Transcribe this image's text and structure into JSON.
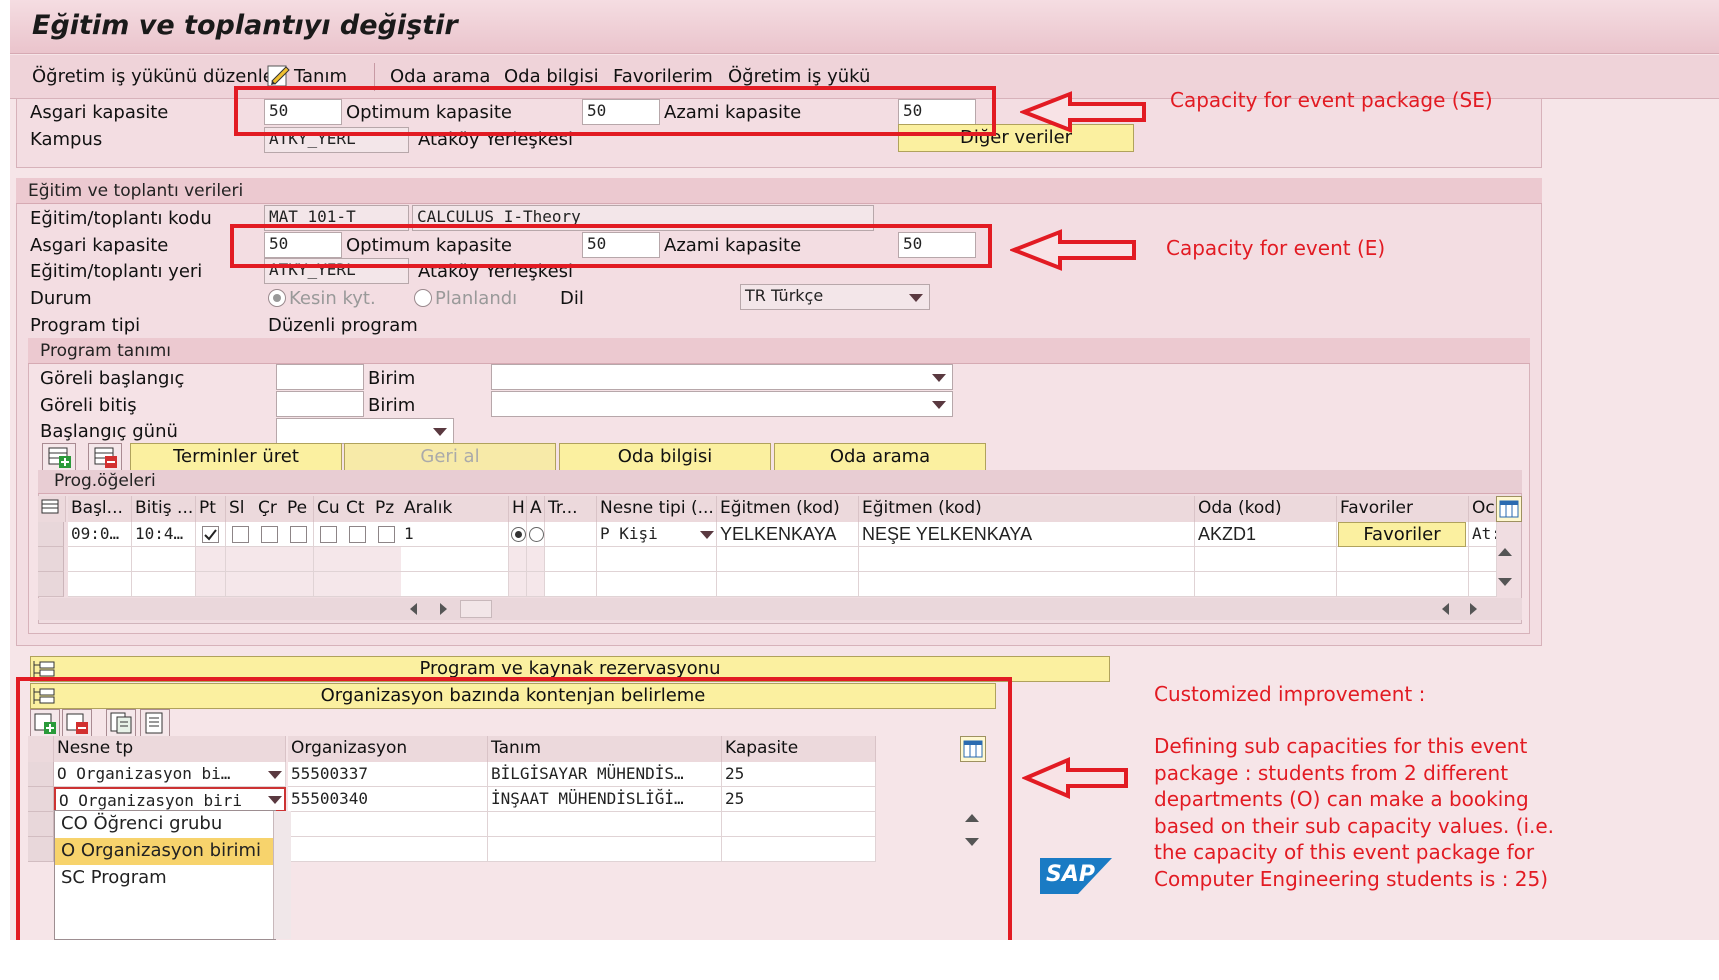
{
  "window": {
    "title": "Eğitim ve toplantıyı değiştir"
  },
  "toolbar": {
    "items": [
      "Öğretim iş yükünü düzenle",
      "Tanım",
      "Oda arama",
      "Oda bilgisi",
      "Favorilerim",
      "Öğretim iş yükü"
    ]
  },
  "package": {
    "min_label": "Asgari kapasite",
    "min_value": "50",
    "opt_label": "Optimum kapasite",
    "opt_value": "50",
    "max_label": "Azami kapasite",
    "max_value": "50",
    "campus_label": "Kampus",
    "campus_value": "ATKY_YERL",
    "campus_desc": "Ataköy Yerleşkesi",
    "other_button": "Diğer veriler"
  },
  "event": {
    "group_title": "Eğitim ve toplantı verileri",
    "code_label": "Eğitim/toplantı kodu",
    "code_value": "MAT 101-T",
    "code_desc": "CALCULUS I-Theory",
    "min_label": "Asgari kapasite",
    "min_value": "50",
    "opt_label": "Optimum kapasite",
    "opt_value": "50",
    "max_label": "Azami kapasite",
    "max_value": "50",
    "location_label": "Eğitim/toplantı yeri",
    "location_value": "ATKY_YERL",
    "location_desc": "Ataköy Yerleşkesi",
    "status_label": "Durum",
    "status_opt1": "Kesin kyt.",
    "status_opt2": "Planlandı",
    "lang_label": "Dil",
    "lang_value": "TR Türkçe",
    "program_type_label": "Program tipi",
    "program_type_value": "Düzenli program"
  },
  "program": {
    "group_title": "Program tanımı",
    "rel_start_label": "Göreli başlangıç",
    "rel_end_label": "Göreli bitiş",
    "unit_label": "Birim",
    "start_day_label": "Başlangıç günü",
    "buttons": [
      "Terminler üret",
      "Geri al",
      "Oda bilgisi",
      "Oda arama"
    ],
    "items_title": "Prog.öğeleri",
    "columns": [
      "Başl...",
      "Bitiş ...",
      "Pt",
      "Sl",
      "Çr",
      "Pe",
      "Cu",
      "Ct",
      "Pz",
      "Aralık",
      "H",
      "A",
      "Tr...",
      "Nesne tipi (...",
      "Eğitmen (kod)",
      "Eğitmen (kod)",
      "Oda (kod)",
      "Favoriler",
      "Oc"
    ],
    "row": {
      "start": "09:0…",
      "end": "10:4…",
      "interval": "1",
      "object_type": "P Kişi",
      "trainer_code": "YELKENKAYA",
      "trainer_name": "NEŞE YELKENKAYA",
      "room": "AKZD1",
      "fav_button": "Favoriler",
      "extra": "At:"
    }
  },
  "reservation_bar": "Program ve kaynak rezervasyonu",
  "quota": {
    "bar_title": "Organizasyon bazında kontenjan belirleme",
    "columns": [
      "Nesne tp",
      "Organizasyon",
      "Tanım",
      "Kapasite"
    ],
    "rows": [
      {
        "type": "O Organizasyon bi…",
        "org": "55500337",
        "desc": "BİLGİSAYAR MÜHENDİS…",
        "cap": "25"
      },
      {
        "type": "O Organizasyon biri",
        "org": "55500340",
        "desc": "İNŞAAT MÜHENDİSLİĞİ…",
        "cap": "25"
      }
    ],
    "dropdown": [
      "CO Öğrenci grubu",
      "O   Organizasyon birimi",
      "SC Program"
    ]
  },
  "annotations": {
    "se": "Capacity for event package (SE)",
    "e": "Capacity for event (E)",
    "custom_title": "Customized improvement :",
    "custom_lines": [
      "Defining sub capacities for this event",
      "package : students from 2 different",
      "departments (O) can make a booking",
      "based on their sub capacity values. (i.e.",
      "the capacity of this event package for",
      "Computer Engineering students is : 25)"
    ]
  },
  "logo": "SAP",
  "colors": {
    "accent_red": "#e21b23",
    "button_yellow": "#fbf0a0",
    "background_pink": "#f6e5e8"
  }
}
